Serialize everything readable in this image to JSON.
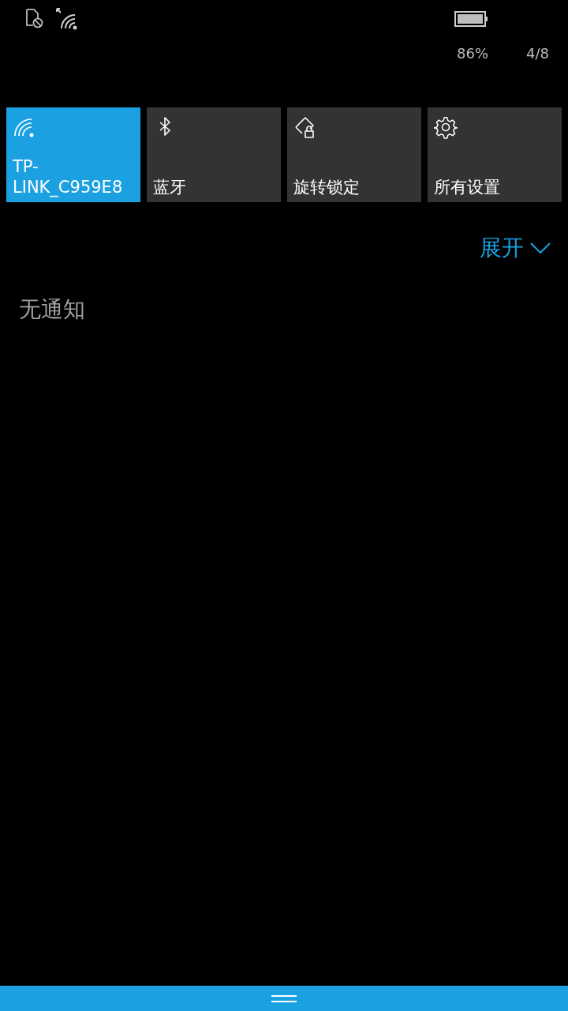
{
  "status_bar": {
    "battery_percent": "86%",
    "page": "4/8"
  },
  "quick_actions": [
    {
      "kind": "wifi",
      "label": "TP-LINK_C959E8",
      "on": true
    },
    {
      "kind": "bluetooth",
      "label": "蓝牙",
      "on": false
    },
    {
      "kind": "rotation-lock",
      "label": "旋转锁定",
      "on": false
    },
    {
      "kind": "settings",
      "label": "所有设置",
      "on": false
    }
  ],
  "expand_button": {
    "label": "展开"
  },
  "notifications": {
    "empty_text": "无通知"
  }
}
